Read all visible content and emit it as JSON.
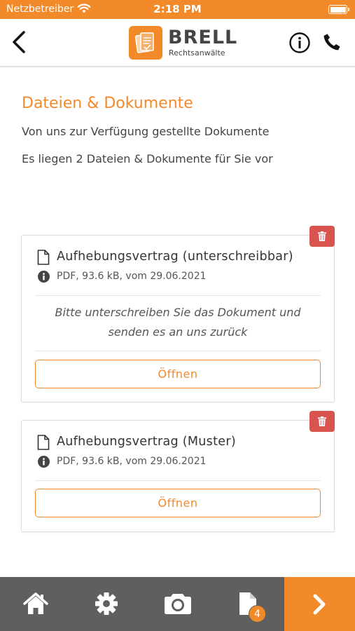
{
  "status_bar": {
    "carrier": "Netzbetreiber",
    "time": "2:18 PM"
  },
  "header": {
    "brand_name": "BRELL",
    "brand_subtitle": "Rechtsanwälte",
    "icons": [
      "back-chevron-icon",
      "info-circle-icon",
      "phone-icon"
    ]
  },
  "section": {
    "title": "Dateien & Dokumente",
    "subtitle": "Von uns zur Verfügung gestellte Dokumente",
    "count_text": "Es liegen 2 Dateien & Dokumente für Sie vor"
  },
  "documents": [
    {
      "title": "Aufhebungsvertrag (unterschreibbar)",
      "meta": "PDF, 93.6 kB, vom 29.06.2021",
      "note_line1": "Bitte unterschreiben Sie das Dokument und",
      "note_line2": "senden es an uns zurück",
      "open_label": "Öffnen"
    },
    {
      "title": "Aufhebungsvertrag (Muster)",
      "meta": "PDF, 93.6 kB, vom 29.06.2021",
      "open_label": "Öffnen"
    }
  ],
  "tabbar": {
    "items": [
      "home-icon",
      "gear-icon",
      "camera-icon",
      "document-icon",
      "chevron-right-icon"
    ],
    "documents_badge": "4"
  },
  "colors": {
    "accent": "#f28a2a",
    "delete": "#d9534f",
    "tabbar": "#5f5f5f"
  }
}
